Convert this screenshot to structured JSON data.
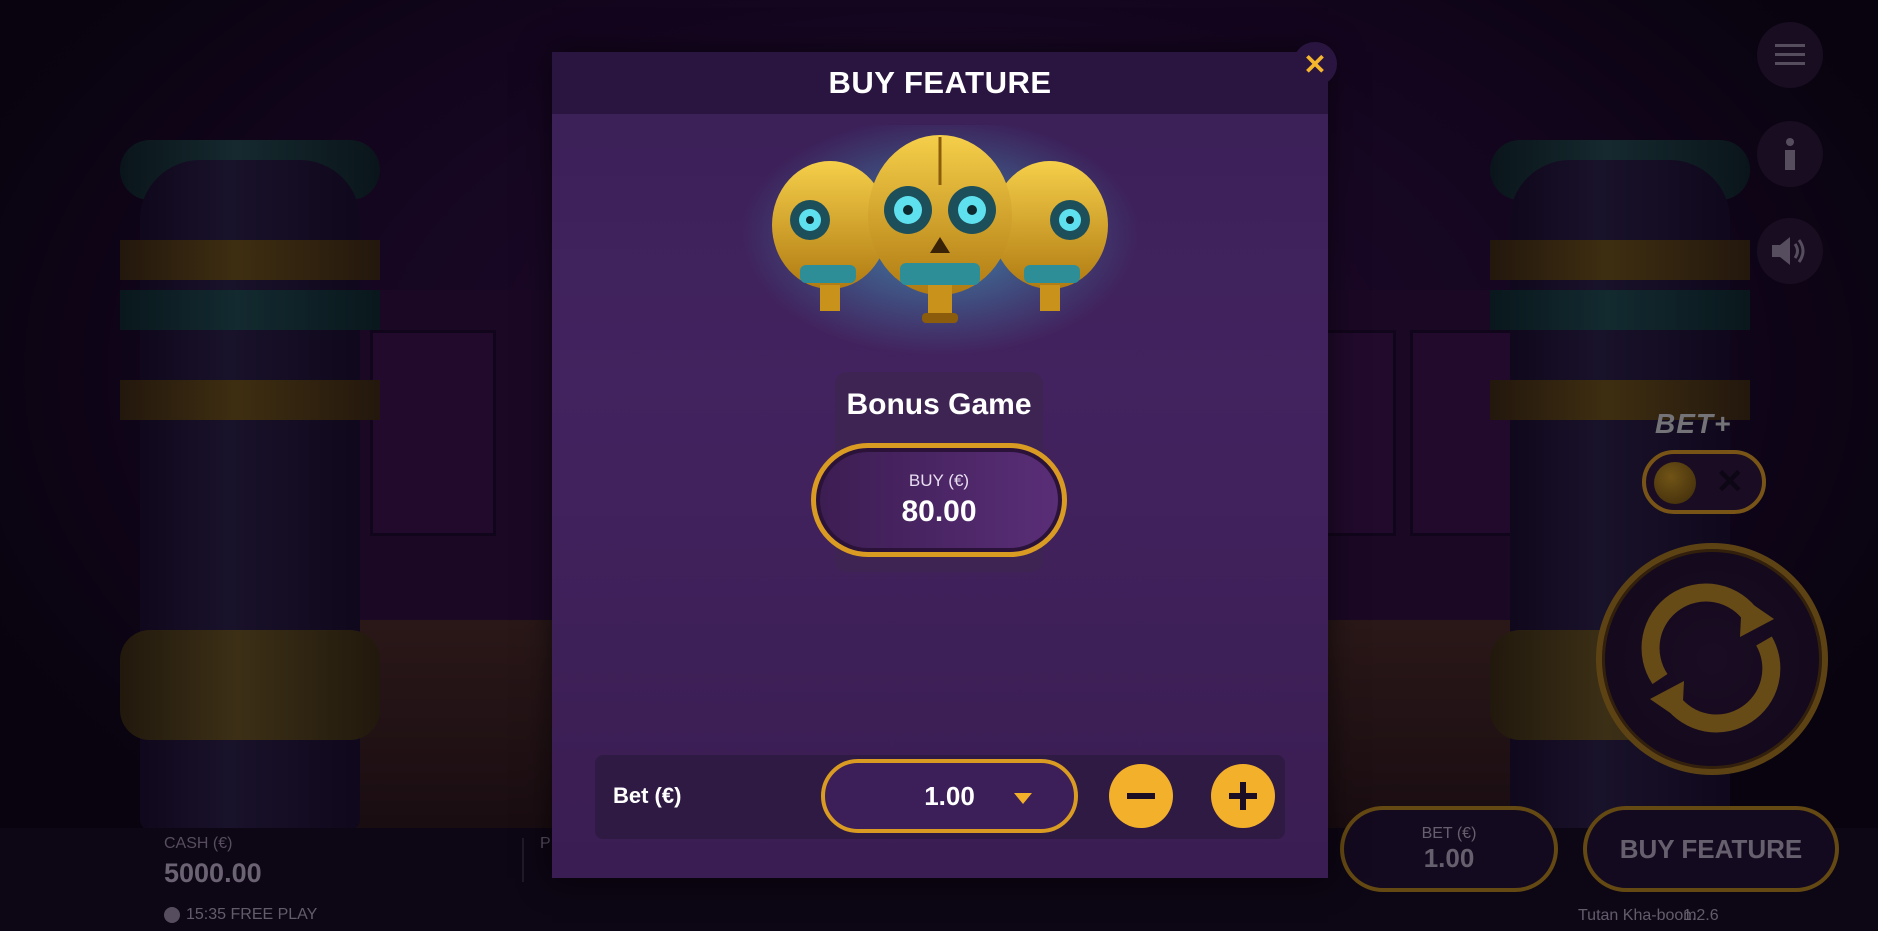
{
  "modal": {
    "title": "BUY FEATURE",
    "feature": {
      "name": "Bonus Game",
      "buy_label": "BUY (€)",
      "price": "80.00"
    },
    "bet": {
      "label": "Bet (€)",
      "value": "1.00"
    }
  },
  "side_controls": {
    "bet_plus_label": "BET+"
  },
  "bottom_bar": {
    "cash_label": "CASH (€)",
    "cash_value": "5000.00",
    "partial_label": "P",
    "status": "15:35 FREE PLAY",
    "bet_label": "BET (€)",
    "bet_value": "1.00",
    "buy_feature_label": "BUY FEATURE",
    "game_name": "Tutan Kha-boom",
    "game_version": "1.2.6"
  },
  "colors": {
    "accent_gold": "#f3b02a",
    "modal_bg": "#3a1f56",
    "header_bg": "#2a1540"
  }
}
